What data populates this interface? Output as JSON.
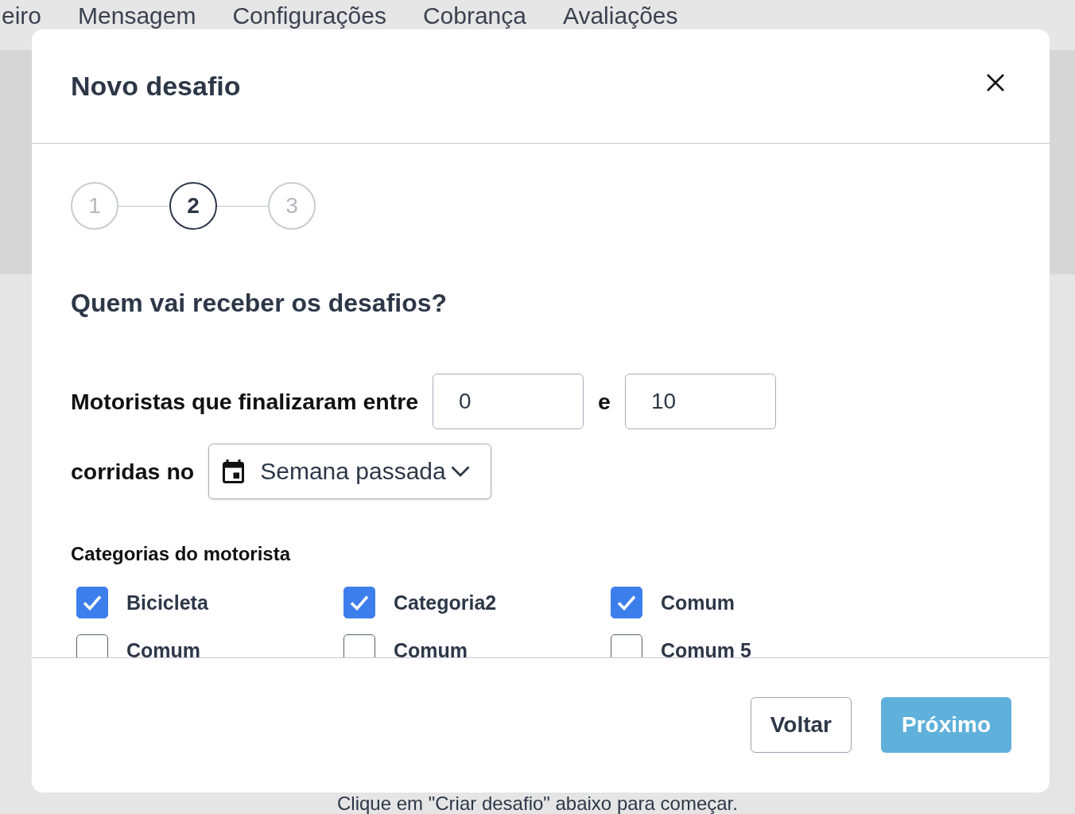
{
  "background": {
    "nav": [
      {
        "label": "eiro"
      },
      {
        "label": "Mensagem"
      },
      {
        "label": "Configurações"
      },
      {
        "label": "Cobrança"
      },
      {
        "label": "Avaliações"
      }
    ],
    "hint": "Clique em \"Criar desafio\" abaixo para começar."
  },
  "modal": {
    "title": "Novo desafio",
    "steps": [
      {
        "label": "1",
        "selected": false
      },
      {
        "label": "2",
        "selected": true
      },
      {
        "label": "3",
        "selected": false
      }
    ],
    "heading": "Quem vai receber os desafios?",
    "range": {
      "label": "Motoristas que finalizaram entre",
      "from": "0",
      "connector": "e",
      "to": "10"
    },
    "period": {
      "label": "corridas no",
      "value": "Semana passada"
    },
    "categories": {
      "title": "Categorias do motorista",
      "items": [
        {
          "label": "Bicicleta",
          "checked": true
        },
        {
          "label": "Categoria2",
          "checked": true
        },
        {
          "label": "Comum",
          "checked": true
        },
        {
          "label": "Comum",
          "checked": false
        },
        {
          "label": "Comum",
          "checked": false
        },
        {
          "label": "Comum 5",
          "checked": false
        }
      ]
    },
    "buttons": [
      {
        "label": "Voltar",
        "kind": "secondary"
      },
      {
        "label": "Próximo",
        "kind": "primary"
      }
    ]
  }
}
